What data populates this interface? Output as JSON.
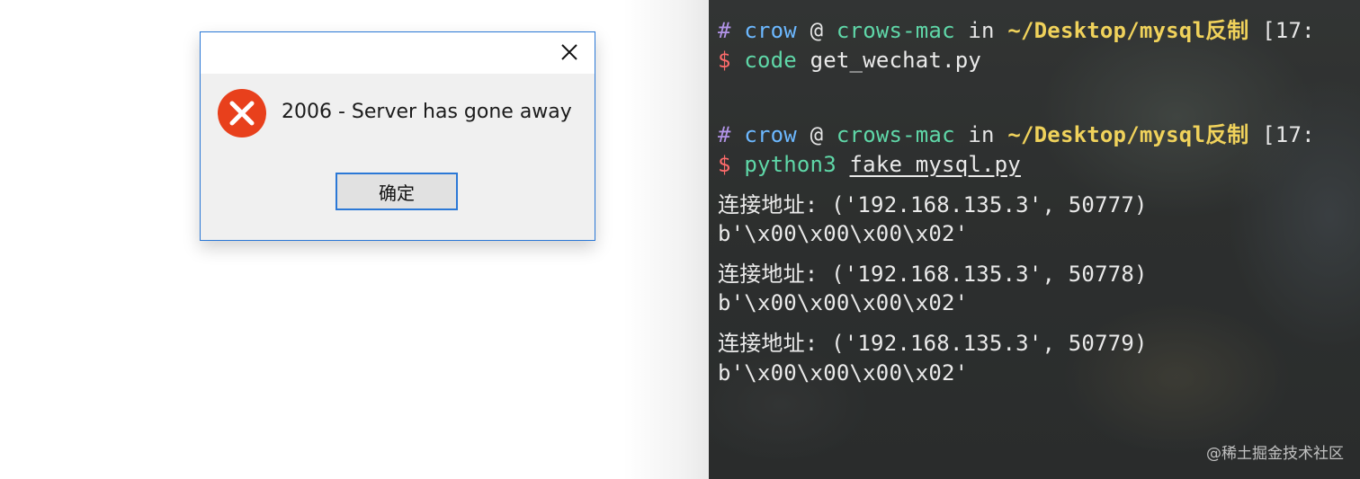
{
  "dialog": {
    "message": "2006 - Server has gone away",
    "ok_label": "确定",
    "close_icon": "close-icon",
    "error_icon": "error-icon",
    "error_color": "#e8401c",
    "border_color": "#2b78d6"
  },
  "terminal": {
    "prompt1": {
      "hash": "#",
      "user": "crow",
      "at": "@",
      "host": "crows-mac",
      "in": "in",
      "path": "~/Desktop/mysql反制",
      "time": "[17:"
    },
    "cmd1": {
      "dollar": "$",
      "command": "code",
      "arg": "get_wechat.py"
    },
    "prompt2": {
      "hash": "#",
      "user": "crow",
      "at": "@",
      "host": "crows-mac",
      "in": "in",
      "path": "~/Desktop/mysql反制",
      "time": "[17:"
    },
    "cmd2": {
      "dollar": "$",
      "command": "python3",
      "arg": "fake_mysql.py"
    },
    "output": [
      "连接地址: ('192.168.135.3', 50777)",
      "b'\\x00\\x00\\x00\\x02'",
      "连接地址: ('192.168.135.3', 50778)",
      "b'\\x00\\x00\\x00\\x02'",
      "连接地址: ('192.168.135.3', 50779)",
      "b'\\x00\\x00\\x00\\x02'"
    ]
  },
  "watermark": "@稀土掘金技术社区"
}
